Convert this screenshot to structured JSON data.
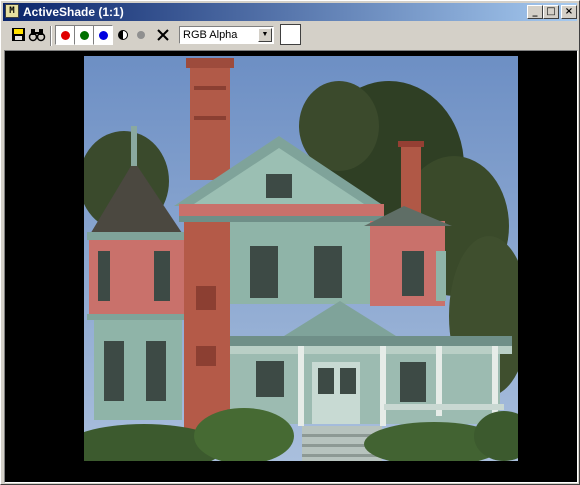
{
  "window": {
    "title": "ActiveShade (1:1)",
    "app_icon_label": "M",
    "minimize_label": "_",
    "maximize_label": "□",
    "close_label": "×"
  },
  "toolbar": {
    "channel_select": {
      "value": "RGB Alpha"
    },
    "colors": {
      "red": "#e00000",
      "green": "#007000",
      "blue": "#0000e0",
      "swatch": "#ffffff"
    },
    "clear_label": "✕"
  },
  "render": {
    "subject": "victorian-house-photo"
  }
}
